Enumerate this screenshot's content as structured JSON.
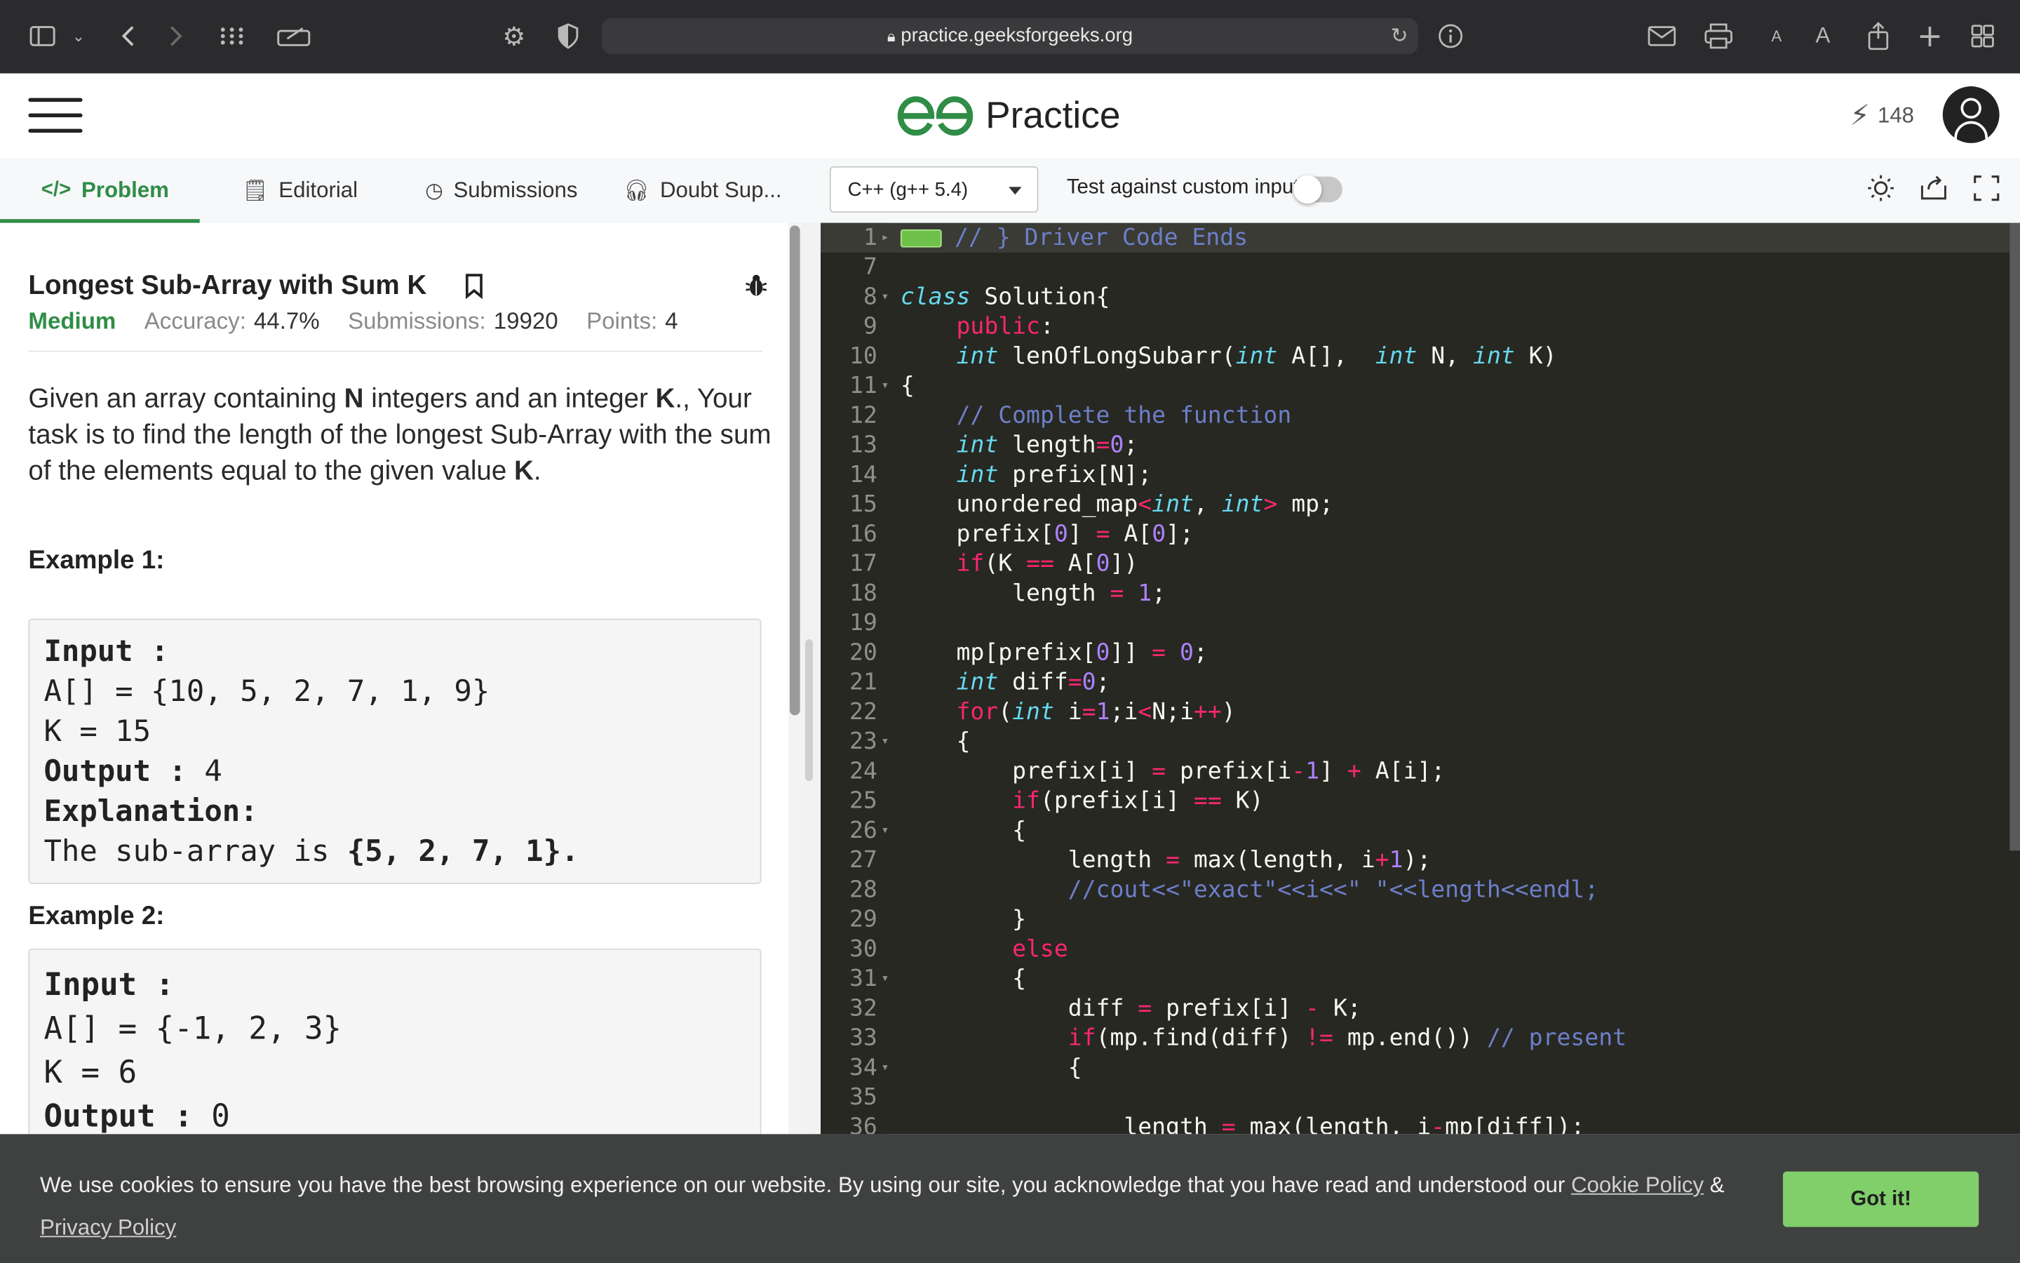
{
  "browser": {
    "url": "practice.geeksforgeeks.org"
  },
  "header": {
    "logo_text": "Practice",
    "streak_count": "148"
  },
  "tabs": [
    {
      "label": "Problem",
      "active": true
    },
    {
      "label": "Editorial"
    },
    {
      "label": "Submissions"
    },
    {
      "label": "Doubt Sup..."
    }
  ],
  "editor_toolbar": {
    "language": "C++ (g++ 5.4)",
    "custom_input_label": "Test against custom input",
    "custom_input_enabled": false
  },
  "problem": {
    "title": "Longest Sub-Array with Sum K",
    "difficulty": "Medium",
    "accuracy_label": "Accuracy:",
    "accuracy_value": "44.7%",
    "submissions_label": "Submissions:",
    "submissions_value": "19920",
    "points_label": "Points:",
    "points_value": "4",
    "description": {
      "p1": "Given an array containing ",
      "n": "N",
      "p2": " integers and an integer ",
      "k1": "K",
      "p3": "., Your task is to find the length of the longest Sub-Array with the sum of the elements equal to the given value ",
      "k2": "K",
      "p4": "."
    },
    "examples": [
      {
        "heading": "Example 1:",
        "input_label": "Input :",
        "input_lines": [
          "A[] = {10, 5, 2, 7, 1, 9}",
          "K = 15"
        ],
        "output_label": "Output :",
        "output_value": " 4",
        "explanation_label": "Explanation:",
        "explanation_text": "The sub-array is ",
        "explanation_bold": "{5, 2, 7, 1}."
      },
      {
        "heading": "Example 2:",
        "input_label": "Input :",
        "input_lines": [
          "A[] = {-1, 2, 3}",
          "K = 6"
        ],
        "output_label": "Output :",
        "output_value": " 0"
      }
    ]
  },
  "code": {
    "line_numbers": [
      "1",
      "7",
      "8",
      "9",
      "10",
      "11",
      "12",
      "13",
      "14",
      "15",
      "16",
      "17",
      "18",
      "19",
      "20",
      "21",
      "22",
      "23",
      "24",
      "25",
      "26",
      "27",
      "28",
      "29",
      "30",
      "31",
      "32",
      "33",
      "34",
      "35",
      "36"
    ]
  },
  "cookie": {
    "text": "We use cookies to ensure you have the best browsing experience on our website. By using our site, you acknowledge that you have read and understood our ",
    "cookie_policy": "Cookie Policy",
    "amp": " & ",
    "privacy_policy": "Privacy Policy",
    "button": "Got it!"
  },
  "colors": {
    "brand_green": "#2f8d46",
    "editor_bg": "#272822",
    "cookie_button": "#80cf6a"
  }
}
